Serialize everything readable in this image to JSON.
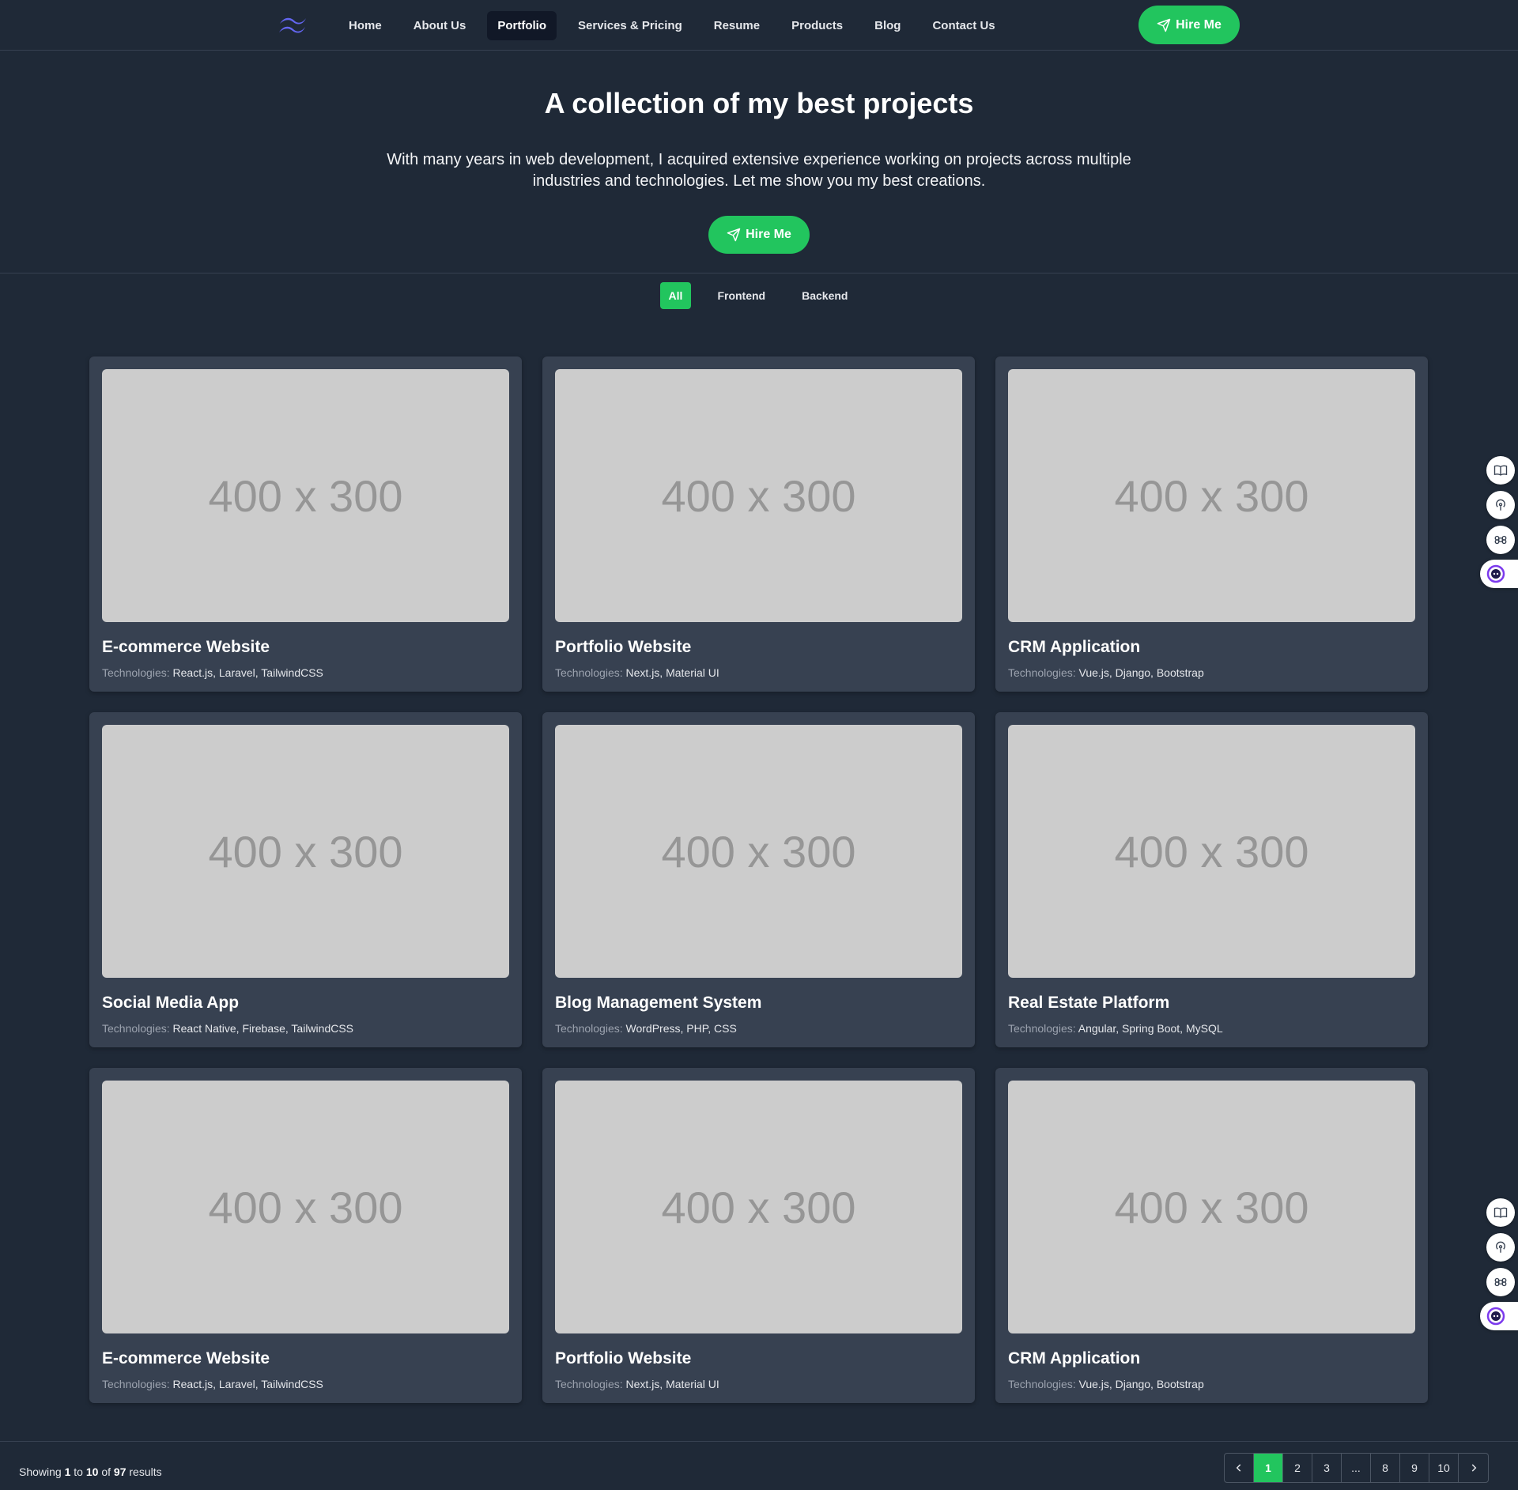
{
  "nav": {
    "links": [
      "Home",
      "About Us",
      "Portfolio",
      "Services & Pricing",
      "Resume",
      "Products",
      "Blog",
      "Contact Us"
    ],
    "active": "Portfolio",
    "hire_label": "Hire Me"
  },
  "hero": {
    "title": "A collection of my best projects",
    "description": "With many years in web development, I acquired extensive experience working on projects across multiple industries and technologies. Let me show you my best creations.",
    "hire_label": "Hire Me"
  },
  "filters": {
    "tabs": [
      "All",
      "Frontend",
      "Backend"
    ],
    "active": "All"
  },
  "projects": [
    {
      "image_text": "400 x 300",
      "title": "E-commerce Website",
      "tech_label": "Technologies:",
      "tech": "React.js, Laravel, TailwindCSS"
    },
    {
      "image_text": "400 x 300",
      "title": "Portfolio Website",
      "tech_label": "Technologies:",
      "tech": "Next.js, Material UI"
    },
    {
      "image_text": "400 x 300",
      "title": "CRM Application",
      "tech_label": "Technologies:",
      "tech": "Vue.js, Django, Bootstrap"
    },
    {
      "image_text": "400 x 300",
      "title": "Social Media App",
      "tech_label": "Technologies:",
      "tech": "React Native, Firebase, TailwindCSS"
    },
    {
      "image_text": "400 x 300",
      "title": "Blog Management System",
      "tech_label": "Technologies:",
      "tech": "WordPress, PHP, CSS"
    },
    {
      "image_text": "400 x 300",
      "title": "Real Estate Platform",
      "tech_label": "Technologies:",
      "tech": "Angular, Spring Boot, MySQL"
    },
    {
      "image_text": "400 x 300",
      "title": "E-commerce Website",
      "tech_label": "Technologies:",
      "tech": "React.js, Laravel, TailwindCSS"
    },
    {
      "image_text": "400 x 300",
      "title": "Portfolio Website",
      "tech_label": "Technologies:",
      "tech": "Next.js, Material UI"
    },
    {
      "image_text": "400 x 300",
      "title": "CRM Application",
      "tech_label": "Technologies:",
      "tech": "Vue.js, Django, Bootstrap"
    }
  ],
  "pagination": {
    "showing_prefix": "Showing",
    "from": "1",
    "to_word": "to",
    "to": "10",
    "of_word": "of",
    "total": "97",
    "results_word": "results",
    "pages": [
      "1",
      "2",
      "3",
      "...",
      "8",
      "9",
      "10"
    ],
    "active_page": "1"
  },
  "side_widgets": [
    "book-icon",
    "podcast-icon",
    "command-icon",
    "assistant-icon"
  ],
  "colors": {
    "background": "#1f2937",
    "card": "#374151",
    "accent": "#22c55e",
    "nav_active": "#111827",
    "placeholder": "#cccccc"
  }
}
